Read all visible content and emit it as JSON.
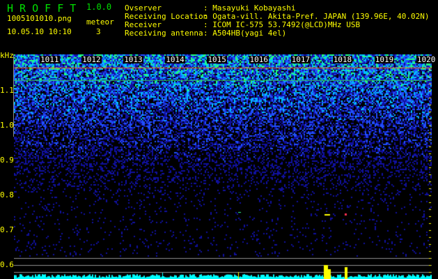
{
  "header": {
    "app_name": "H R O F F T",
    "version": "1.0.0",
    "filename": "1005101010.png",
    "datetime": "10.05.10 10:10",
    "meteor_label": "meteor",
    "meteor_count": "3",
    "info": [
      {
        "label": "Ovserver",
        "value": "Masayuki Kobayashi"
      },
      {
        "label": "Receiving Location",
        "value": "Ogata-vill. Akita-Pref. JAPAN (139.96E, 40.02N)"
      },
      {
        "label": "Receiver",
        "value": "ICOM IC-575 53.7492(@LCD)MHz USB"
      },
      {
        "label": "Receiving antenna",
        "value": "A504HB(yagi 4el)"
      }
    ]
  },
  "spectrogram": {
    "unit": "kHz",
    "time_labels": [
      "1011",
      "1012",
      "1013",
      "1014",
      "1015",
      "1016",
      "1017",
      "1018",
      "1019",
      "1020"
    ],
    "freq_labels": [
      "1.1",
      "1.0",
      "0.9",
      "0.8",
      "0.7",
      "0.6"
    ],
    "colors": {
      "text": "#ffff00",
      "title": "#00e000",
      "noise": "#2040ff",
      "signal": "#ffff00",
      "bars": "#00ffff"
    }
  }
}
